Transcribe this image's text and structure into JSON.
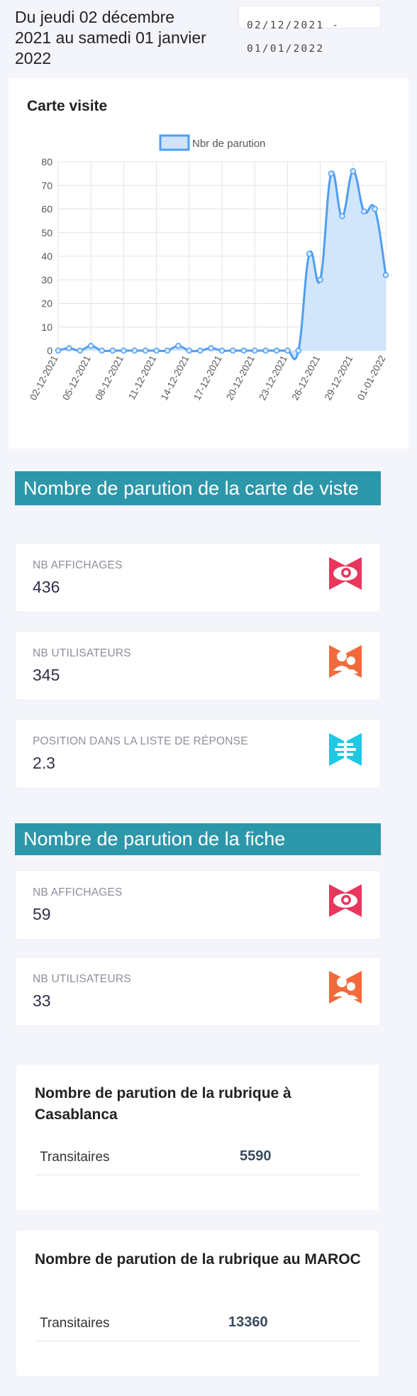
{
  "header": {
    "period_text": "Du jeudi 02 décembre 2021 au samedi 01 janvier 2022",
    "date_range_value": "02/12/2021 - 01/01/2022"
  },
  "chart_card": {
    "title": "Carte visite"
  },
  "chart_data": {
    "type": "line",
    "title": "",
    "xlabel": "",
    "ylabel": "",
    "ylim": [
      0,
      80
    ],
    "yticks": [
      0,
      10,
      20,
      30,
      40,
      50,
      60,
      70,
      80
    ],
    "x": [
      "02-12-2021",
      "03-12-2021",
      "04-12-2021",
      "05-12-2021",
      "06-12-2021",
      "07-12-2021",
      "08-12-2021",
      "09-12-2021",
      "10-12-2021",
      "11-12-2021",
      "12-12-2021",
      "13-12-2021",
      "14-12-2021",
      "15-12-2021",
      "16-12-2021",
      "17-12-2021",
      "18-12-2021",
      "19-12-2021",
      "20-12-2021",
      "21-12-2021",
      "22-12-2021",
      "23-12-2021",
      "24-12-2021",
      "25-12-2021",
      "26-12-2021",
      "27-12-2021",
      "28-12-2021",
      "29-12-2021",
      "30-12-2021",
      "31-12-2021",
      "01-01-2022"
    ],
    "xticks_shown": [
      "02-12-2021",
      "05-12-2021",
      "08-12-2021",
      "11-12-2021",
      "14-12-2021",
      "17-12-2021",
      "20-12-2021",
      "23-12-2021",
      "26-12-2021",
      "29-12-2021",
      "01-01-2022"
    ],
    "series": [
      {
        "name": "Nbr de parution",
        "color": "#4f9ef0",
        "fill": "#cfe4fb",
        "values": [
          0,
          1,
          0,
          2,
          0,
          0,
          0,
          0,
          0,
          0,
          0,
          2,
          0,
          0,
          1,
          0,
          0,
          0,
          0,
          0,
          0,
          0,
          0,
          41,
          30,
          75,
          57,
          76,
          59,
          60,
          32
        ]
      }
    ],
    "legend": "top-center",
    "grid": true
  },
  "section_carte": {
    "title": "Nombre de parution de la carte de viste",
    "stats": [
      {
        "label": "NB AFFICHAGES",
        "value": "436",
        "icon": "eye-icon",
        "icon_color": "#e8365d"
      },
      {
        "label": "NB UTILISATEURS",
        "value": "345",
        "icon": "users-icon",
        "icon_color": "#f26a3c"
      },
      {
        "label": "POSITION DANS LA LISTE DE RÉPONSE",
        "value": "2.3",
        "icon": "list-position-icon",
        "icon_color": "#1fc8e3"
      }
    ]
  },
  "section_fiche": {
    "title": "Nombre de parution de la fiche",
    "stats": [
      {
        "label": "NB AFFICHAGES",
        "value": "59",
        "icon": "eye-icon",
        "icon_color": "#e8365d"
      },
      {
        "label": "NB UTILISATEURS",
        "value": "33",
        "icon": "users-icon",
        "icon_color": "#f26a3c"
      }
    ]
  },
  "rubrique_casablanca": {
    "title": "Nombre de parution de la rubrique à Casablanca",
    "rows": [
      {
        "label": "Transitaires",
        "value": "5590"
      }
    ]
  },
  "rubrique_maroc": {
    "title": "Nombre de parution de la rubrique au MAROC",
    "rows": [
      {
        "label": "Transitaires",
        "value": "13360"
      }
    ]
  }
}
